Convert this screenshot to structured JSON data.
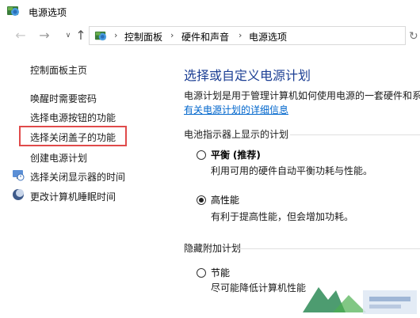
{
  "window": {
    "title": "电源选项"
  },
  "address_bar": {
    "segments": [
      "控制面板",
      "硬件和声音",
      "电源选项"
    ]
  },
  "sidebar": {
    "items": [
      {
        "label": "控制面板主页"
      },
      {
        "label": "唤醒时需要密码"
      },
      {
        "label": "选择电源按钮的功能"
      },
      {
        "label": "选择关闭盖子的功能"
      },
      {
        "label": "创建电源计划"
      },
      {
        "label": "选择关闭显示器的时间"
      },
      {
        "label": "更改计算机睡眠时间"
      }
    ]
  },
  "main": {
    "heading": "选择或自定义电源计划",
    "description": "电源计划是用于管理计算机如何使用电源的一套硬件和系",
    "learn_more_link": "有关电源计划的详细信息",
    "section_battery": "电池指示器上显示的计划",
    "section_hidden": "隐藏附加计划",
    "plans": [
      {
        "name": "平衡",
        "tag": "(推荐)",
        "desc": "利用可用的硬件自动平衡功耗与性能。",
        "selected": false
      },
      {
        "name": "高性能",
        "desc": "有利于提高性能，但会增加功耗。",
        "selected": true
      },
      {
        "name": "节能",
        "desc": "尽可能降低计算机性能",
        "selected": false
      }
    ]
  },
  "colors": {
    "heading": "#1c3f94",
    "link": "#0066cc",
    "highlight": "#e04a4a"
  },
  "icons": {
    "title": "control-panel-icon",
    "address": "control-panel-icon",
    "display_time": "monitor-clock-icon",
    "sleep_time": "moon-icon"
  }
}
